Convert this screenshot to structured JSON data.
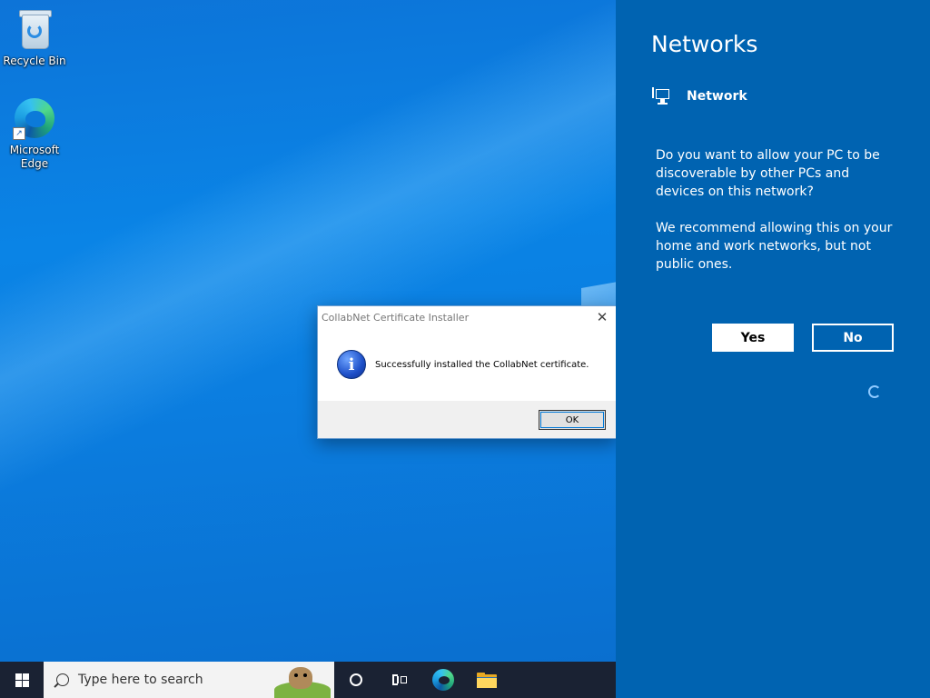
{
  "desktop": {
    "icons": [
      {
        "label": "Recycle Bin",
        "icon": "recycle-bin-icon"
      },
      {
        "label": "Microsoft Edge",
        "icon": "edge-icon"
      }
    ]
  },
  "dialog": {
    "title": "CollabNet Certificate Installer",
    "close_glyph": "✕",
    "message": "Successfully installed the CollabNet certificate.",
    "icon": "info-icon",
    "ok_label": "OK"
  },
  "network_pane": {
    "title": "Networks",
    "network_name": "Network",
    "question": "Do you want to allow your PC to be discoverable by other PCs and devices on this network?",
    "recommendation": "We recommend allowing this on your home and work networks, but not public ones.",
    "yes_label": "Yes",
    "no_label": "No",
    "background_color": "#0063b1"
  },
  "taskbar": {
    "search_placeholder": "Type here to search",
    "pinned": [
      "cortana-icon",
      "task-view-icon",
      "edge-icon",
      "file-explorer-icon"
    ],
    "background_color": "#1a2233"
  }
}
